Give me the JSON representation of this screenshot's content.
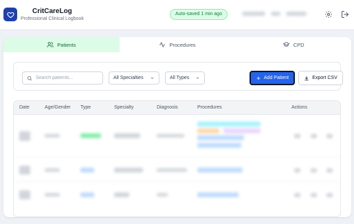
{
  "app": {
    "title": "CritCareLog",
    "subtitle": "Professional Clinical Logbook",
    "logo_icon": "heart-icon",
    "brand_color": "#1e40af"
  },
  "status": {
    "autosave": "Auto-saved 1 min ago"
  },
  "header_icons": [
    "gear-icon",
    "logout-icon"
  ],
  "tabs": [
    {
      "label": "Patients",
      "icon": "users-icon",
      "active": true
    },
    {
      "label": "Procedures",
      "icon": "activity-icon",
      "active": false
    },
    {
      "label": "CPD",
      "icon": "graduation-cap-icon",
      "active": false
    }
  ],
  "toolbar": {
    "search_placeholder": "Search patients...",
    "specialty_filter": "All Specialties",
    "type_filter": "All Types",
    "add_button": "Add Patient",
    "export_button": "Export CSV"
  },
  "table": {
    "columns": [
      "Date",
      "Age/Gender",
      "Type",
      "Specialty",
      "Diagnosis",
      "Procedures",
      "Actions"
    ]
  }
}
